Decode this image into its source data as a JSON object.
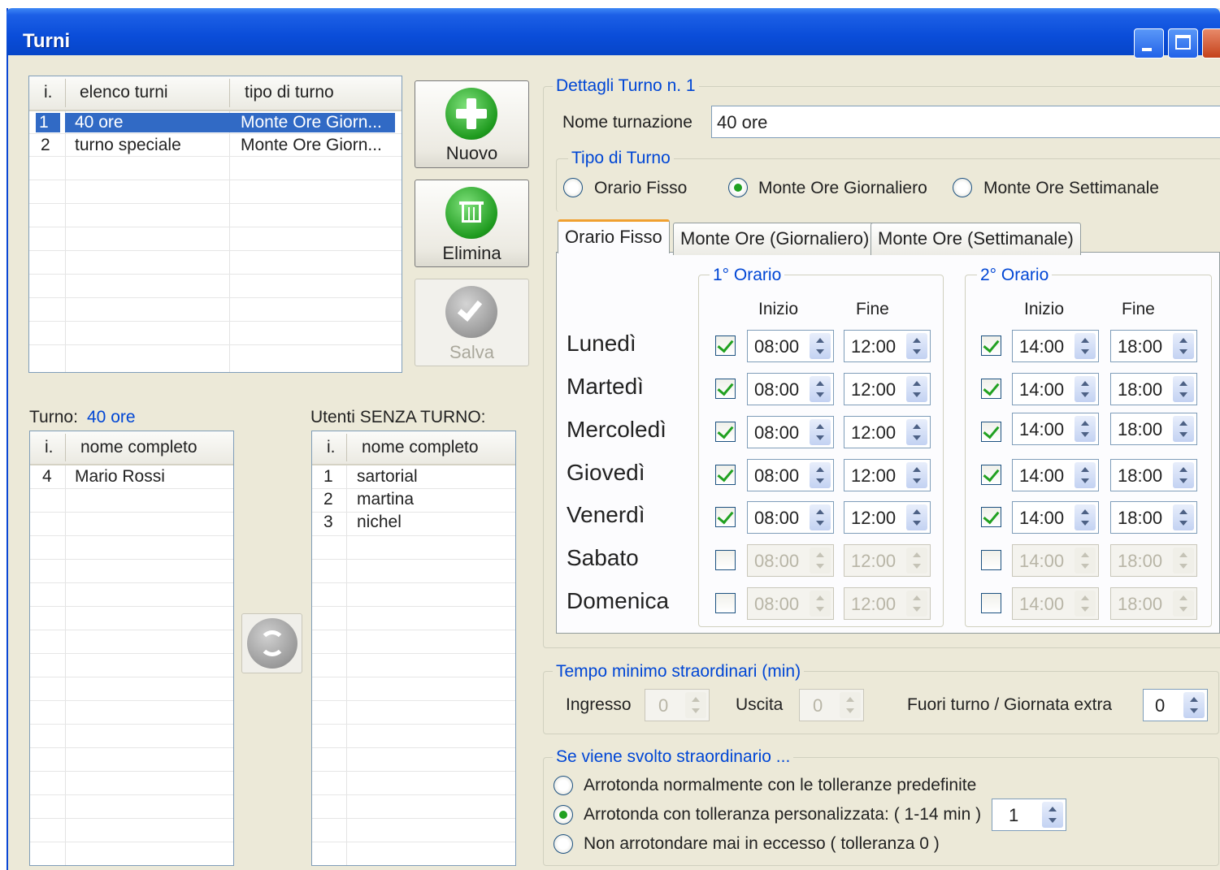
{
  "window": {
    "title": "Turni"
  },
  "turni_list": {
    "headers": [
      "i.",
      "elenco turni",
      "tipo di turno"
    ],
    "rows": [
      {
        "i": "1",
        "name": "40 ore",
        "type": "Monte Ore Giorn..."
      },
      {
        "i": "2",
        "name": "turno speciale",
        "type": "Monte Ore Giorn..."
      }
    ]
  },
  "buttons": {
    "nuovo": "Nuovo",
    "elimina": "Elimina",
    "salva": "Salva"
  },
  "turno_users": {
    "label": "Turno:",
    "value": "40 ore",
    "headers": [
      "i.",
      "nome completo"
    ],
    "rows": [
      {
        "i": "4",
        "name": "Mario Rossi"
      }
    ]
  },
  "senza_turno": {
    "label": "Utenti SENZA TURNO:",
    "headers": [
      "i.",
      "nome completo"
    ],
    "rows": [
      {
        "i": "1",
        "name": "sartorial"
      },
      {
        "i": "2",
        "name": "martina"
      },
      {
        "i": "3",
        "name": "nichel"
      }
    ]
  },
  "details": {
    "title": "Dettagli Turno n. 1",
    "nome_label": "Nome turnazione",
    "nome_value": "40 ore",
    "tipo_title": "Tipo di Turno",
    "tipo_options": [
      "Orario Fisso",
      "Monte Ore Giornaliero",
      "Monte Ore Settimanale"
    ],
    "tipo_selected": "Monte Ore Giornaliero",
    "tabs": [
      "Orario Fisso",
      "Monte Ore (Giornaliero)",
      "Monte Ore (Settimanale)"
    ],
    "active_tab": "Orario Fisso",
    "orario1_title": "1° Orario",
    "orario2_title": "2° Orario",
    "inizio": "Inizio",
    "fine": "Fine",
    "days": [
      {
        "name": "Lunedì",
        "on": true,
        "s1": "08:00",
        "e1": "12:00",
        "s2": "14:00",
        "e2": "18:00"
      },
      {
        "name": "Martedì",
        "on": true,
        "s1": "08:00",
        "e1": "12:00",
        "s2": "14:00",
        "e2": "18:00"
      },
      {
        "name": "Mercoledì",
        "on": true,
        "s1": "08:00",
        "e1": "12:00",
        "s2": "14:00",
        "e2": "18:00"
      },
      {
        "name": "Giovedì",
        "on": true,
        "s1": "08:00",
        "e1": "12:00",
        "s2": "14:00",
        "e2": "18:00"
      },
      {
        "name": "Venerdì",
        "on": true,
        "s1": "08:00",
        "e1": "12:00",
        "s2": "14:00",
        "e2": "18:00"
      },
      {
        "name": "Sabato",
        "on": false,
        "s1": "08:00",
        "e1": "12:00",
        "s2": "14:00",
        "e2": "18:00"
      },
      {
        "name": "Domenica",
        "on": false,
        "s1": "08:00",
        "e1": "12:00",
        "s2": "14:00",
        "e2": "18:00"
      }
    ]
  },
  "straordinari": {
    "title": "Tempo minimo straordinari (min)",
    "ingresso_label": "Ingresso",
    "ingresso_value": "0",
    "uscita_label": "Uscita",
    "uscita_value": "0",
    "fuori_label": "Fuori turno / Giornata extra",
    "fuori_value": "0"
  },
  "svolto": {
    "title": "Se viene svolto straordinario ...",
    "options": [
      "Arrotonda normalmente con le tolleranze predefinite",
      "Arrotonda con tolleranza personalizzata: ( 1-14 min )",
      "Non arrotondare mai in eccesso ( tolleranza 0 )"
    ],
    "selected_index": 1,
    "tolleranza_value": "1"
  },
  "icons": {
    "nuovo": "plus-icon",
    "elimina": "trash-icon",
    "salva": "check-icon",
    "sposta": "swap-arrows-icon"
  }
}
